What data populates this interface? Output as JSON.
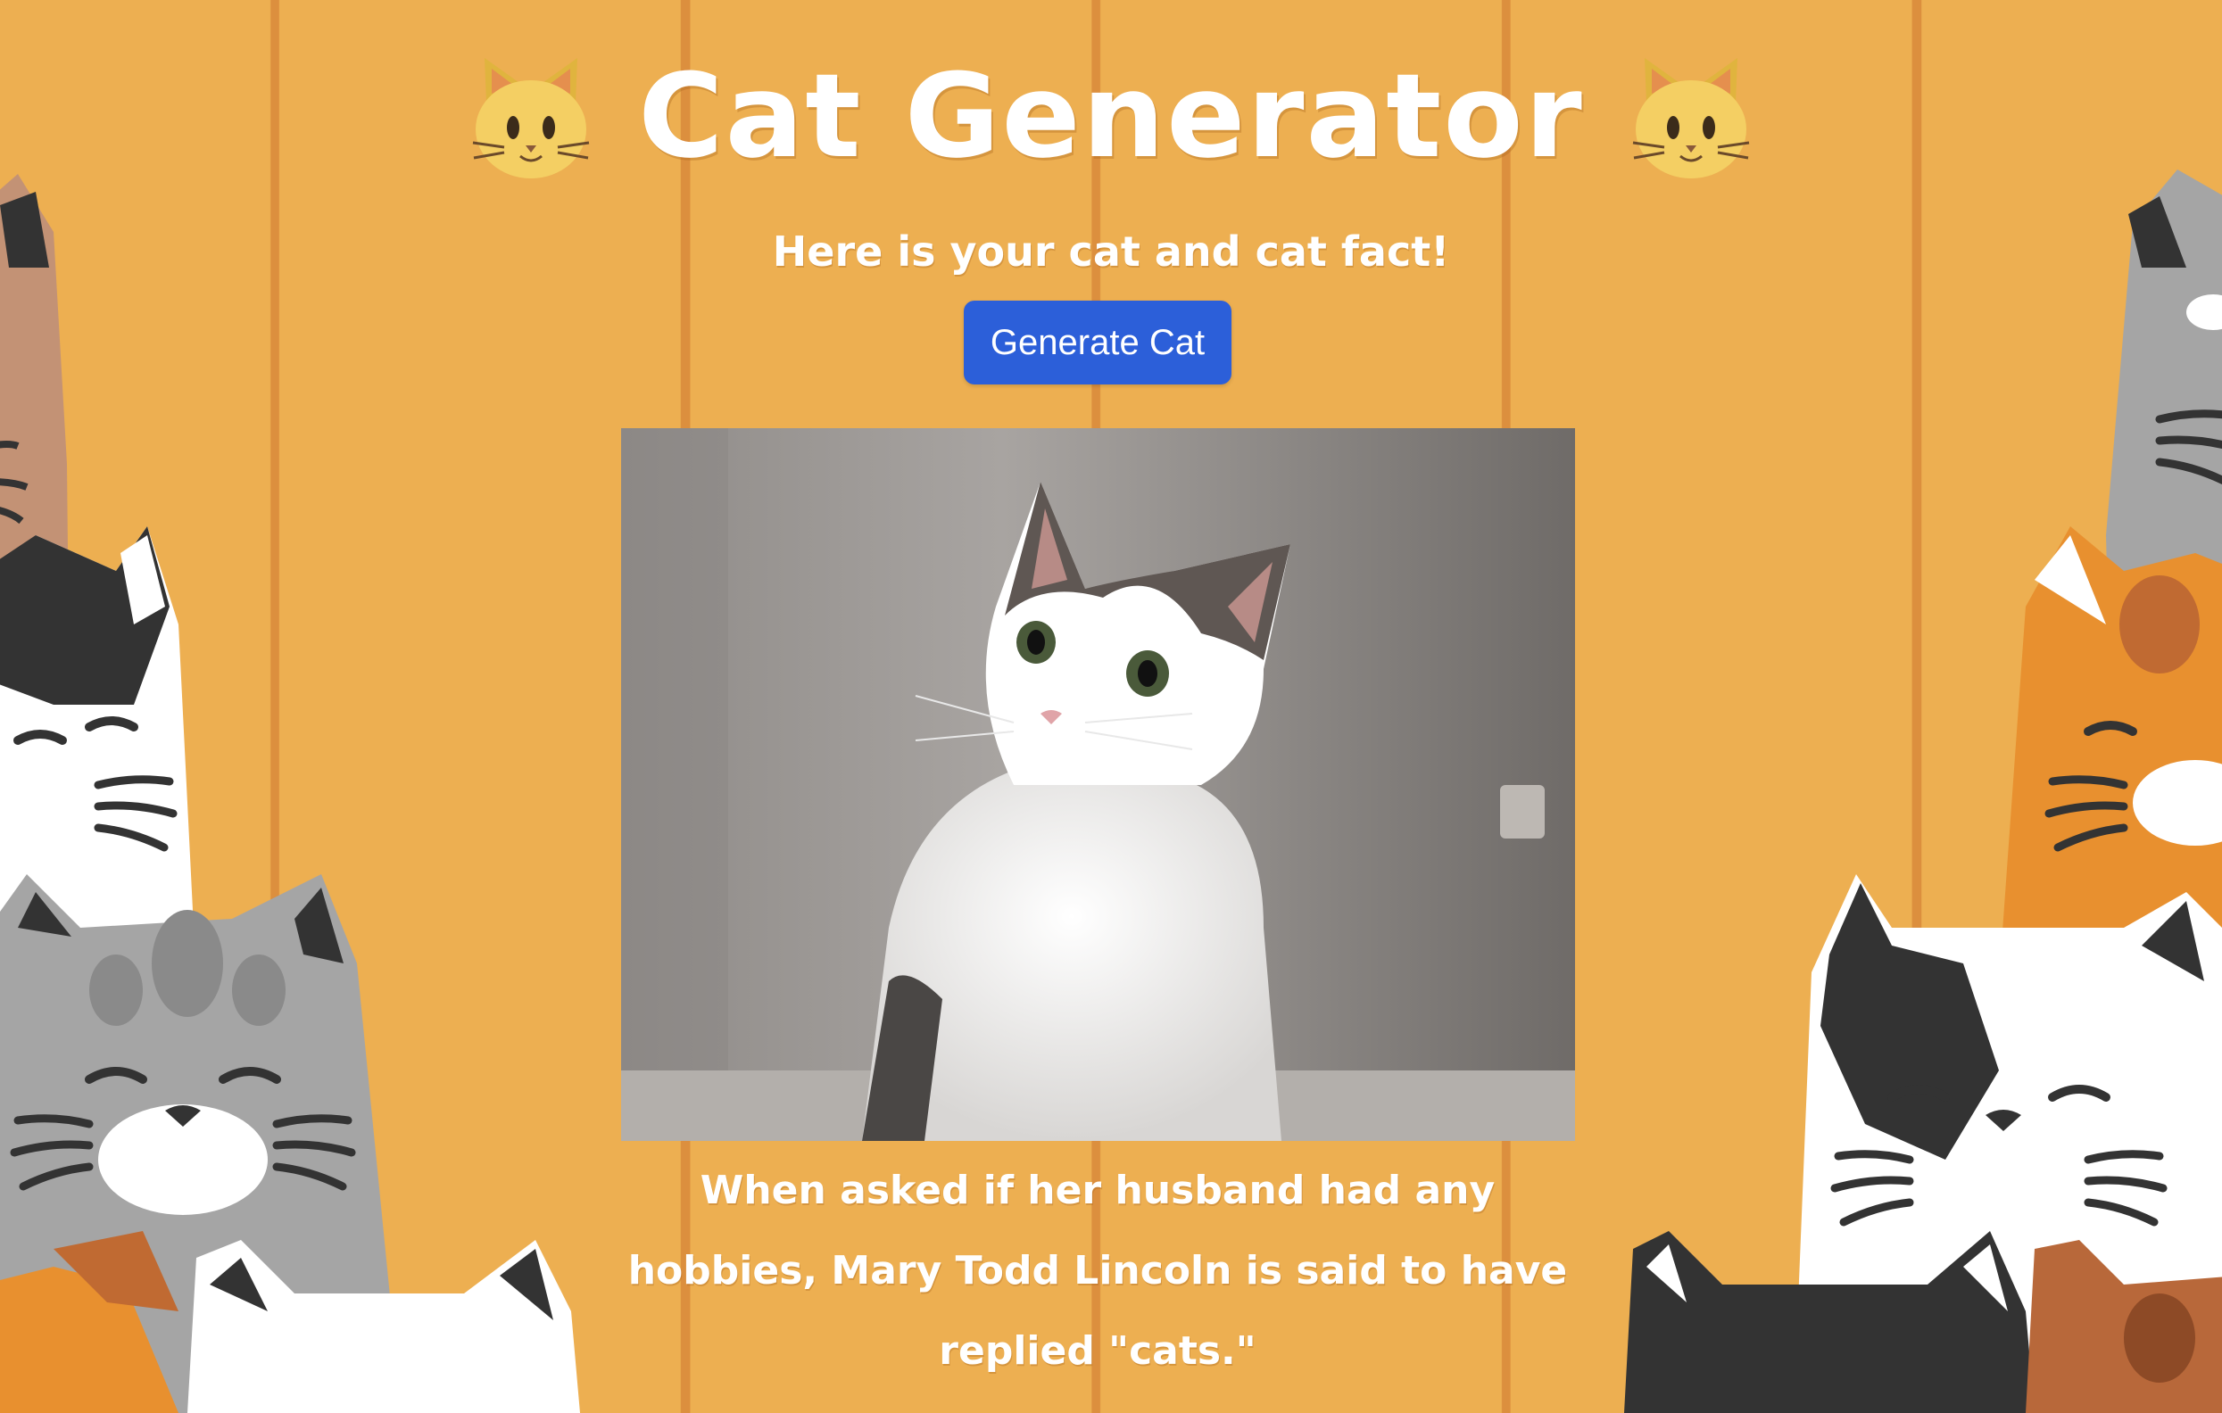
{
  "header": {
    "title": "Cat Generator",
    "left_icon": "cat-face-emoji",
    "right_icon": "cat-face-emoji"
  },
  "subtitle": "Here is your cat and cat fact!",
  "generate_button": {
    "label": "Generate Cat"
  },
  "cat_image": {
    "subject": "white and tabby cat looking up"
  },
  "cat_fact": "When asked if her husband had any hobbies, Mary Todd Lincoln is said to have replied \"cats.\"",
  "colors": {
    "background": "#edaf51",
    "stripe": "#dc8f3e",
    "button": "#2c5fd9",
    "text": "#ffffff"
  }
}
